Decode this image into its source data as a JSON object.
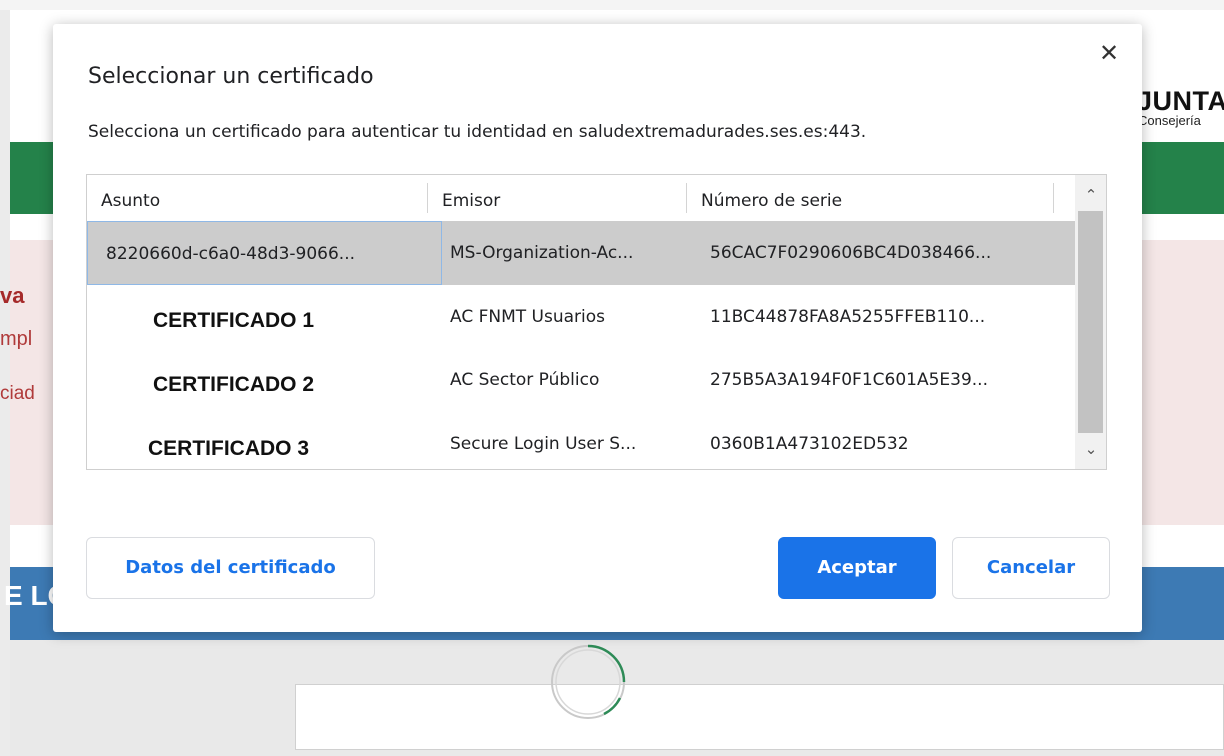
{
  "background": {
    "header_brand": "JUNTA",
    "header_sub": "Consejería",
    "side_text_1": "va",
    "side_text_2": "mpl",
    "side_text_3": "ciad",
    "banner_text": "E LO"
  },
  "dialog": {
    "title": "Seleccionar un certificado",
    "description": "Selecciona un certificado para autenticar tu identidad en saludextremadurades.ses.es:443.",
    "close_glyph": "✕",
    "columns": [
      "Asunto",
      "Emisor",
      "Número de serie"
    ],
    "rows": [
      {
        "subject": "8220660d-c6a0-48d3-9066...",
        "issuer": "MS-Organization-Ac...",
        "serial": "56CAC7F0290606BC4D038466...",
        "selected": true
      },
      {
        "subject": "CERTIFICADO 1",
        "issuer": "AC FNMT Usuarios",
        "serial": "11BC44878FA8A5255FFEB110...",
        "selected": false
      },
      {
        "subject": "CERTIFICADO 2",
        "issuer": "AC Sector Público",
        "serial": "275B5A3A194F0F1C601A5E39...",
        "selected": false
      },
      {
        "subject": "CERTIFICADO 3",
        "issuer": "Secure Login User S...",
        "serial": "0360B1A473102ED532",
        "selected": false
      }
    ],
    "scroll_up_glyph": "⌃",
    "scroll_down_glyph": "⌄",
    "buttons": {
      "details": "Datos del certificado",
      "accept": "Aceptar",
      "cancel": "Cancelar"
    }
  },
  "colors": {
    "accent": "#1a73e8",
    "header_green": "#24824a",
    "banner_blue": "#3d7ab4"
  }
}
